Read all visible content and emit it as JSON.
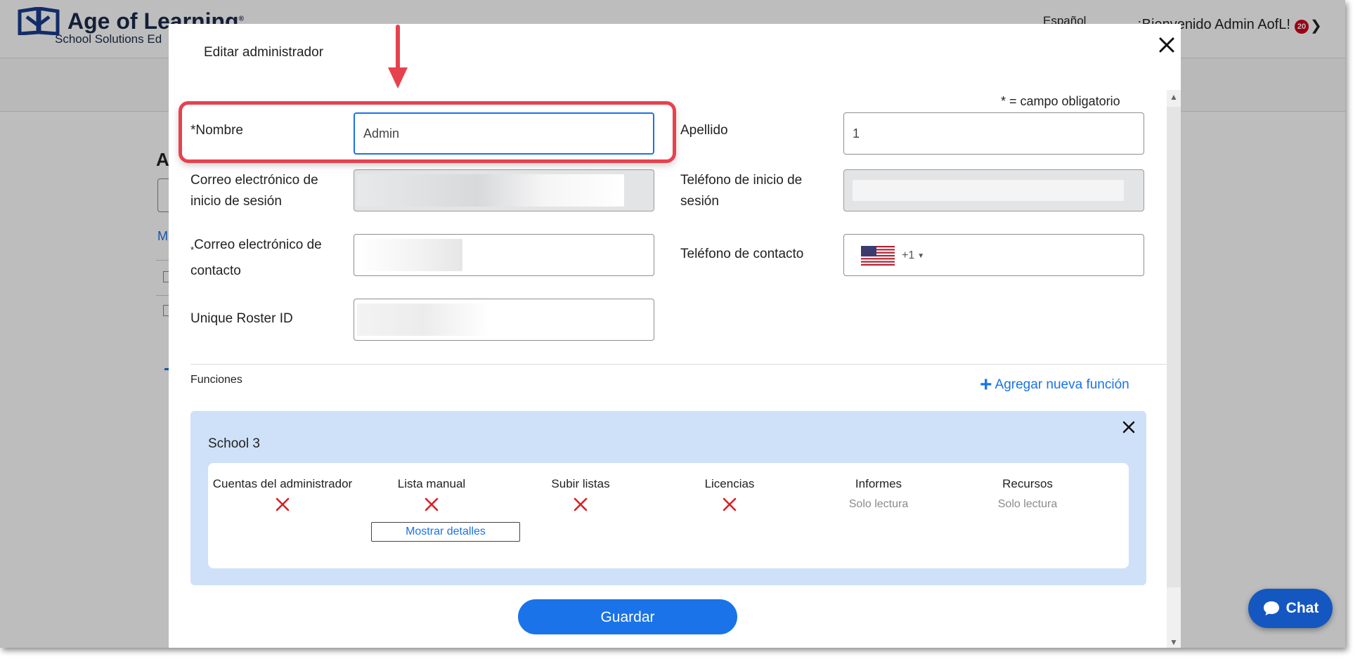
{
  "header": {
    "brand_title": "Age of Learning",
    "brand_trademark": "®",
    "brand_subtitle": "School Solutions Ed",
    "language": "Español",
    "welcome": "¡Bienvenido Admin AofL!",
    "notification_count": "20"
  },
  "background": {
    "page_title_partial": "A",
    "link_partial": "M"
  },
  "modal": {
    "title": "Editar administrador",
    "required_note": "* = campo obligatorio",
    "fields": {
      "first_name": {
        "label": "*Nombre",
        "value": "Admin"
      },
      "last_name": {
        "label": "Apellido",
        "value": "1"
      },
      "login_email": {
        "label": "Correo electrónico de inicio de sesión",
        "value": ""
      },
      "login_phone": {
        "label": "Teléfono de inicio de sesión",
        "value": ""
      },
      "contact_email": {
        "label_marker": "*",
        "label": "Correo electrónico de contacto",
        "value": ""
      },
      "contact_phone": {
        "label": "Teléfono de contacto",
        "dial_code": "+1",
        "country_flag": "us-flag-icon"
      },
      "roster_id": {
        "label": "Unique Roster ID",
        "value": ""
      }
    },
    "functions_label": "Funciones",
    "add_role_label": "Agregar nueva función",
    "role": {
      "name": "School 3",
      "permissions": [
        {
          "title": "Cuentas del administrador",
          "status": "none",
          "icon": "x-icon"
        },
        {
          "title": "Lista manual",
          "status": "none",
          "icon": "x-icon",
          "details_button": "Mostrar detalles"
        },
        {
          "title": "Subir listas",
          "status": "none",
          "icon": "x-icon"
        },
        {
          "title": "Licencias",
          "status": "none",
          "icon": "x-icon"
        },
        {
          "title": "Informes",
          "status": "Solo lectura"
        },
        {
          "title": "Recursos",
          "status": "Solo lectura"
        }
      ]
    },
    "save_label": "Guardar"
  },
  "chat": {
    "label": "Chat"
  },
  "colors": {
    "accent": "#1a73e8",
    "annotation": "#e8414e",
    "role_card": "#cfe1f8",
    "deny_x": "#d91f26",
    "chat": "#1557c0"
  }
}
